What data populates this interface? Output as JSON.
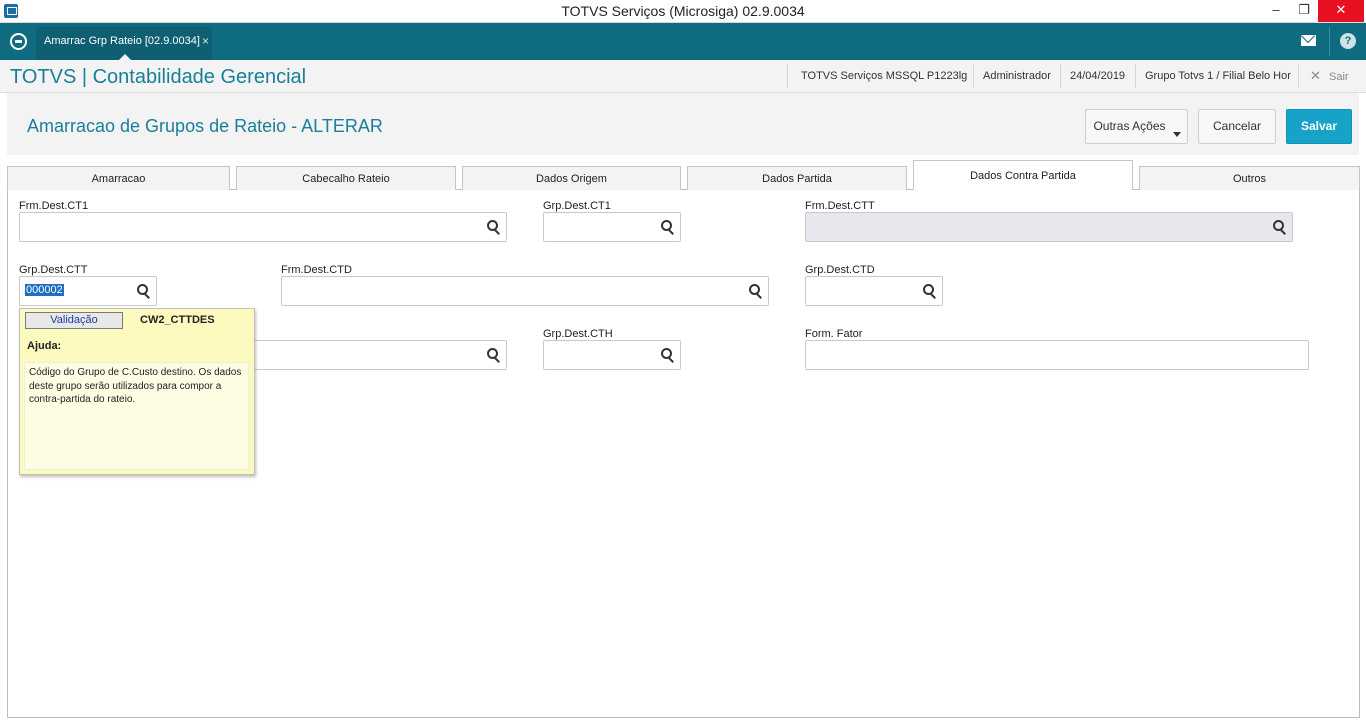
{
  "window": {
    "title": "TOTVS Serviços (Microsiga) 02.9.0034",
    "minimize": "–",
    "maximize": "❐",
    "close": "✕"
  },
  "topbar": {
    "tab_label": "Amarrac Grp Rateio [02.9.0034]",
    "tab_close": "×",
    "help": "?"
  },
  "header": {
    "module_title": "TOTVS | Contabilidade Gerencial",
    "server": "TOTVS Serviços MSSQL P1223lg",
    "user": "Administrador",
    "date": "24/04/2019",
    "branch": "Grupo Totvs 1 / Filial Belo Hor",
    "exit_icon": "✕",
    "exit_label": "Sair"
  },
  "page": {
    "title": "Amarracao de Grupos de Rateio - ALTERAR",
    "btn_outras": "Outras Ações",
    "btn_cancelar": "Cancelar",
    "btn_salvar": "Salvar"
  },
  "tabs": [
    "Amarracao",
    "Cabecalho Rateio",
    "Dados Origem",
    "Dados Partida",
    "Dados Contra Partida",
    "Outros"
  ],
  "active_tab": "Dados Contra Partida",
  "fields": {
    "frm_ct1": {
      "label": "Frm.Dest.CT1",
      "value": ""
    },
    "grp_ct1": {
      "label": "Grp.Dest.CT1",
      "value": ""
    },
    "frm_ctt": {
      "label": "Frm.Dest.CTT",
      "value": ""
    },
    "grp_ctt": {
      "label": "Grp.Dest.CTT",
      "value": "000002"
    },
    "frm_ctd": {
      "label": "Frm.Dest.CTD",
      "value": ""
    },
    "grp_ctd": {
      "label": "Grp.Dest.CTD",
      "value": ""
    },
    "frm_cth": {
      "label": "",
      "value": ""
    },
    "grp_cth": {
      "label": "Grp.Dest.CTH",
      "value": ""
    },
    "form_fator": {
      "label": "Form. Fator",
      "value": ""
    }
  },
  "help_popup": {
    "button": "Validação",
    "field_name": "CW2_CTTDES",
    "heading": "Ajuda:",
    "text": "Código do Grupo de C.Custo destino. Os dados deste grupo serão utilizados para compor a contra-partida do rateio."
  },
  "colors": {
    "teal": "#0f6b7f",
    "accent": "#1a7f9b",
    "save": "#17a2c8",
    "popup_bg": "#fdfabf"
  }
}
